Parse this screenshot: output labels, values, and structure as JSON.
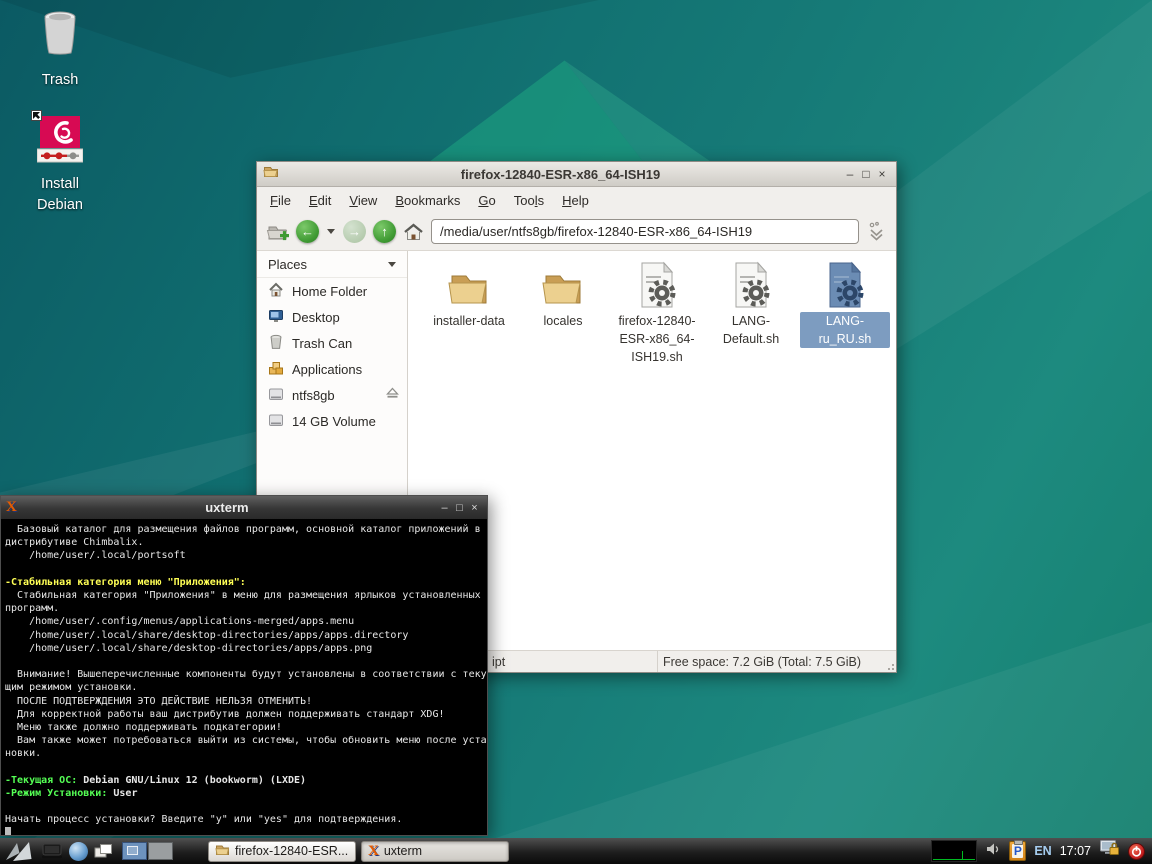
{
  "desktop_icons": [
    {
      "label": "Trash",
      "icon": "trash-desktop-icon"
    },
    {
      "label": "Install Debian",
      "icon": "debian-installer-icon",
      "shortcut_badge": true
    }
  ],
  "file_manager": {
    "title": "firefox-12840-ESR-x86_64-ISH19",
    "window_controls": {
      "minimize": "–",
      "maximize": "□",
      "close": "×"
    },
    "menu": [
      {
        "label": "File",
        "accel": 0
      },
      {
        "label": "Edit",
        "accel": 0
      },
      {
        "label": "View",
        "accel": 0
      },
      {
        "label": "Bookmarks",
        "accel": 0
      },
      {
        "label": "Go",
        "accel": 0
      },
      {
        "label": "Tools",
        "accel": 3
      },
      {
        "label": "Help",
        "accel": 0
      }
    ],
    "path": "/media/user/ntfs8gb/firefox-12840-ESR-x86_64-ISH19",
    "places": {
      "header": "Places",
      "items": [
        {
          "label": "Home Folder",
          "icon": "home-icon"
        },
        {
          "label": "Desktop",
          "icon": "desktop-icon"
        },
        {
          "label": "Trash Can",
          "icon": "trash-icon"
        },
        {
          "label": "Applications",
          "icon": "applications-icon"
        },
        {
          "label": "ntfs8gb",
          "icon": "drive-icon",
          "eject": true
        },
        {
          "label": "14 GB Volume",
          "icon": "drive-icon"
        }
      ]
    },
    "files": [
      {
        "name": "installer-data",
        "icon": "folder-icon",
        "selected": false
      },
      {
        "name": "locales",
        "icon": "folder-icon",
        "selected": false
      },
      {
        "name": "firefox-12840-ESR-x86_64-ISH19.sh",
        "icon": "shell-script-icon",
        "selected": false
      },
      {
        "name": "LANG-Default.sh",
        "icon": "shell-script-icon",
        "selected": false
      },
      {
        "name": "LANG-ru_RU.sh",
        "icon": "shell-script-icon",
        "selected": true
      }
    ],
    "statusbar": {
      "left_visible_fragment": "ipt",
      "free_space": "Free space: 7.2 GiB (Total: 7.5 GiB)"
    }
  },
  "terminal": {
    "title": "uxterm",
    "window_controls": {
      "minimize": "–",
      "maximize": "□",
      "close": "×"
    },
    "lines": [
      [
        {
          "t": "  Базовый каталог для размещения файлов программ, основной каталог приложений в",
          "c": "w"
        }
      ],
      [
        {
          "t": "дистрибутиве Chimbalix.",
          "c": "w"
        }
      ],
      [
        {
          "t": "    /home/user/.local/portsoft",
          "c": "w"
        }
      ],
      [],
      [
        {
          "t": "-Стабильная категория меню \"Приложения\":",
          "c": "y"
        }
      ],
      [
        {
          "t": "  Стабильная категория \"Приложения\" в меню для размещения ярлыков установленных",
          "c": "w"
        }
      ],
      [
        {
          "t": "программ.",
          "c": "w"
        }
      ],
      [
        {
          "t": "    /home/user/.config/menus/applications-merged/apps.menu",
          "c": "w"
        }
      ],
      [
        {
          "t": "    /home/user/.local/share/desktop-directories/apps/apps.directory",
          "c": "w"
        }
      ],
      [
        {
          "t": "    /home/user/.local/share/desktop-directories/apps/apps.png",
          "c": "w"
        }
      ],
      [],
      [
        {
          "t": "  Внимание! Вышеперечисленные компоненты будут установлены в соответствии с теку",
          "c": "w"
        }
      ],
      [
        {
          "t": "щим режимом установки.",
          "c": "w"
        }
      ],
      [
        {
          "t": "  ПОСЛЕ ПОДТВЕРЖДЕНИЯ ЭТО ДЕЙСТВИЕ НЕЛЬЗЯ ОТМЕНИТЬ!",
          "c": "w"
        }
      ],
      [
        {
          "t": "  Для корректной работы ваш дистрибутив должен поддерживать стандарт XDG!",
          "c": "w"
        }
      ],
      [
        {
          "t": "  Меню также должно поддерживать подкатегории!",
          "c": "w"
        }
      ],
      [
        {
          "t": "  Вам также может потребоваться выйти из системы, чтобы обновить меню после уста",
          "c": "w"
        }
      ],
      [
        {
          "t": "новки.",
          "c": "w"
        }
      ],
      [],
      [
        {
          "t": "-Текущая ОС:",
          "c": "g"
        },
        {
          "t": " Debian GNU/Linux 12 (bookworm) (LXDE)",
          "c": "wb"
        }
      ],
      [
        {
          "t": "-Режим Установки:",
          "c": "g"
        },
        {
          "t": " User",
          "c": "wb"
        }
      ],
      [],
      [
        {
          "t": "Начать процесс установки? Введите \"y\" или \"yes\" для подтверждения.",
          "c": "w"
        }
      ],
      [
        {
          "cursor": true
        }
      ]
    ]
  },
  "taskbar": {
    "menu_button_icon": "chimbalix-menu-icon",
    "launchers": [
      {
        "icon": "file-manager-launcher-icon"
      },
      {
        "icon": "browser-launcher-icon"
      },
      {
        "icon": "show-desktop-icon"
      }
    ],
    "pager": {
      "desktops": 2,
      "active": 1
    },
    "tasks": [
      {
        "label": "firefox-12840-ESR...",
        "icon": "folder-icon",
        "pressed": false
      },
      {
        "label": "uxterm",
        "icon": "xterm-icon",
        "pressed": true
      }
    ],
    "tray": {
      "cpu_monitor_icon": "cpu-monitor-icon",
      "volume_icon": "volume-icon",
      "clipboard_badge": "P",
      "keyboard_layout": "EN",
      "clock": "17:07",
      "lock_icon": "lock-screen-icon",
      "power_icon": "power-icon"
    }
  },
  "colors": {
    "selection_blue": "#7d9cc0",
    "terminal_yellow": "#ffff55",
    "terminal_green": "#55ff55",
    "debian_red": "#d70a53",
    "keyboard_layout_blue": "#a6cdf0",
    "power_red": "#c41f1f",
    "wallpaper_teal": "#177c78"
  }
}
